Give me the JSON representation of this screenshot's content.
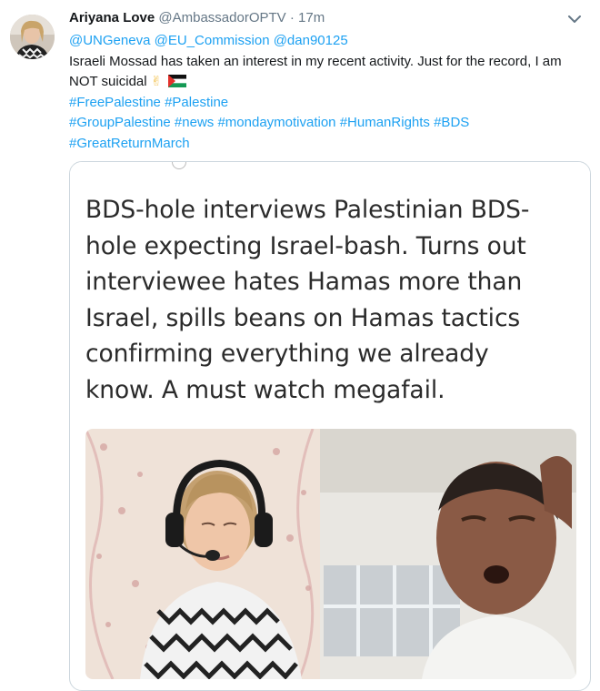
{
  "tweet": {
    "display_name": "Ariyana Love",
    "handle": "@AmbassadorOPTV",
    "separator": "·",
    "time": "17m",
    "mentions": [
      "@UNGeneva",
      "@EU_Commission",
      "@dan90125"
    ],
    "text_line1": "Israeli Mossad has taken an interest in my recent activity. Just for the record, I am",
    "text_line2": "NOT suicidal",
    "emoji": "✌",
    "hashtags_line1": [
      "#FreePalestine",
      "#Palestine"
    ],
    "hashtags_line2": [
      "#GroupPalestine",
      "#news",
      "#mondaymotivation",
      "#HumanRights",
      "#BDS"
    ],
    "hashtags_line3": [
      "#GreatReturnMarch"
    ]
  },
  "card": {
    "headline_lines": [
      "BDS-hole interviews Palestinian BDS-",
      "hole expecting Israel-bash. Turns out",
      "interviewee hates Hamas more than",
      "Israel, spills beans on Hamas tactics",
      "confirming everything we already",
      "know. A must watch megafail."
    ]
  },
  "icons": {
    "caret": "chevron-down-icon",
    "flag": "palestine-flag-icon",
    "emoji": "victory-hand-icon"
  },
  "colors": {
    "link": "#1da1f2",
    "muted": "#657786",
    "text": "#14171a",
    "border": "#ccd6dd"
  }
}
